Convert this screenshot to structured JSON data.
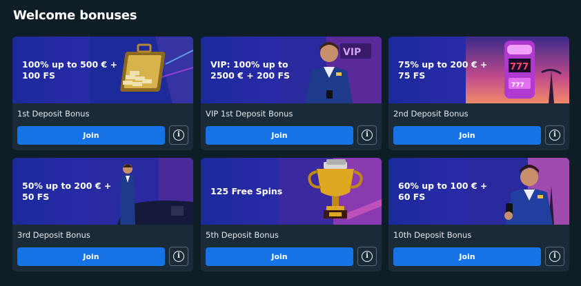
{
  "page": {
    "title": "Welcome bonuses"
  },
  "colors": {
    "background": "#0f1d27",
    "card": "#1a2b37",
    "join_button": "#1474e6"
  },
  "bonuses": [
    {
      "headline": "100% up to 500 € + 100 FS",
      "name": "1st Deposit Bonus",
      "join_label": "Join",
      "info_icon": "info-icon",
      "art": "gold-briefcase"
    },
    {
      "headline": "VIP: 100% up to 2500 € + 200 FS",
      "name": "VIP 1st Deposit Bonus",
      "join_label": "Join",
      "info_icon": "info-icon",
      "art": "vip-man"
    },
    {
      "headline": "75% up to 200 € + 75 FS",
      "name": "2nd Deposit Bonus",
      "join_label": "Join",
      "info_icon": "info-icon",
      "art": "slot-machine"
    },
    {
      "headline": "50% up to 200 € + 50 FS",
      "name": "3rd Deposit Bonus",
      "join_label": "Join",
      "info_icon": "info-icon",
      "art": "man-with-car"
    },
    {
      "headline": "125 Free Spins",
      "name": "5th Deposit Bonus",
      "join_label": "Join",
      "info_icon": "info-icon",
      "art": "gold-trophy"
    },
    {
      "headline": "60% up to 100 € + 60 FS",
      "name": "10th Deposit Bonus",
      "join_label": "Join",
      "info_icon": "info-icon",
      "art": "man-with-phone"
    }
  ]
}
